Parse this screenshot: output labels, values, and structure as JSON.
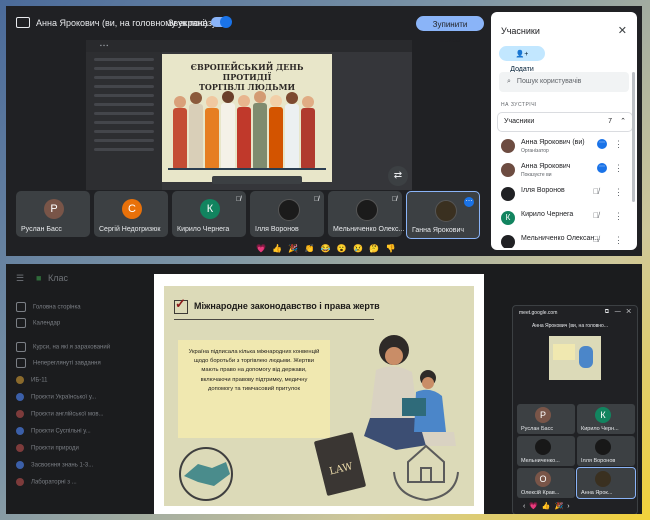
{
  "top": {
    "presenter_label": "Анна Ярокович (ви, на головному екрані)",
    "sound_label": "Звук показу",
    "stop_button": "Зупинити показ",
    "slide": {
      "title_line1": "ЄВРОПЕЙСЬКИЙ ДЕНЬ ПРОТИДІЇ",
      "title_line2": "ТОРГІВЛІ ЛЮДЬМИ"
    },
    "tiles": [
      {
        "name": "Руслан Басс",
        "initial": "Р",
        "color": "#795548"
      },
      {
        "name": "Сергій Недогризюк",
        "initial": "С",
        "color": "#e8710a"
      },
      {
        "name": "Кирило Чернега",
        "initial": "К",
        "color": "#12845f"
      },
      {
        "name": "Ілля Воронов",
        "initial": "",
        "color": "#1b1b1b"
      },
      {
        "name": "Мельниченко Олекс...",
        "initial": "",
        "color": "#1b1b1b"
      },
      {
        "name": "Ганна Ярокович",
        "initial": "",
        "color": "#1b1b1b"
      }
    ],
    "reactions": "💗 👍 🎉 👏 😂 😮 😢 🤔 👎",
    "people_panel": {
      "header": "Учасники",
      "add_button": "Додати",
      "search_placeholder": "Пошук користувачів",
      "section_label": "НА ЗУСТРІЧІ",
      "group_label": "Учасники",
      "group_count": "7",
      "participants": [
        {
          "name": "Анна Ярокович (ви)",
          "sub": "Організатор",
          "initial": "",
          "color": "#6d4c41"
        },
        {
          "name": "Анна Ярокович",
          "sub": "Показуєте ви",
          "initial": "",
          "color": "#6d4c41"
        },
        {
          "name": "Ілля Воронов",
          "sub": "",
          "initial": "",
          "color": "#202124"
        },
        {
          "name": "Кирило Чернега",
          "sub": "",
          "initial": "К",
          "color": "#12845f"
        },
        {
          "name": "Мельниченко Олексан...",
          "sub": "",
          "initial": "",
          "color": "#202124"
        }
      ]
    }
  },
  "bottom": {
    "app_name": "Клас",
    "sidebar_items": [
      "Головна сторінка",
      "Календар",
      "Курси, на які я зарахований",
      "Непереглянуті завдання",
      "ИБ-11",
      "Проєкти Української у...",
      "Проєкти англійської мов...",
      "Проєкти Суспільні у...",
      "Проєкти природи",
      "Засвоєння знань 1-3...",
      "Лабораторні з ..."
    ],
    "slide": {
      "title": "Міжнародне законодавство і права жертв",
      "body": "Україна підписала кілька міжнародних конвенцій щодо боротьби з торгівлею людьми. Жертви мають право на допомогу від держави, включаючи правову підтримку, медичну допомогу та тимчасовий притулок",
      "book_label": "LAW"
    },
    "float_window": {
      "title": "meet.google.com",
      "presenter_label": "Анна Ярокович (ви, на головно...",
      "tiles": [
        {
          "name": "Руслан Басс",
          "initial": "Р",
          "color": "#795548"
        },
        {
          "name": "Кирило Черн...",
          "initial": "К",
          "color": "#12845f"
        },
        {
          "name": "Мельниченко...",
          "initial": "",
          "color": "#181818"
        },
        {
          "name": "Ілля Воронов",
          "initial": "",
          "color": "#181818"
        },
        {
          "name": "Олексій Крав...",
          "initial": "О",
          "color": "#795548"
        },
        {
          "name": "Анна Ярок...",
          "initial": "",
          "color": "#181818"
        }
      ],
      "reactions": "‹ 💗 👍 🎉 ›"
    }
  }
}
